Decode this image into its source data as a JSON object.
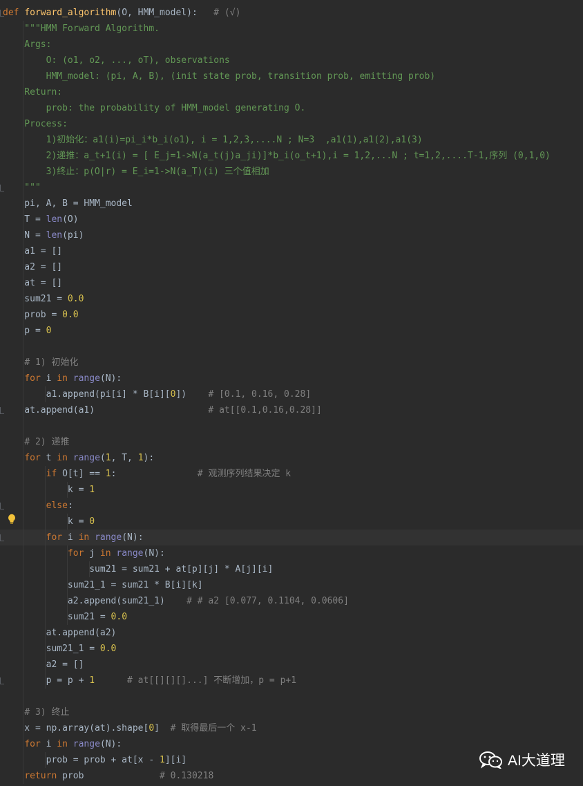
{
  "editor": {
    "lines": [
      "def forward_algorithm(O, HMM_model):   # (√)",
      "    \"\"\"HMM Forward Algorithm.",
      "    Args:",
      "        O: (o1, o2, ..., oT), observations",
      "        HMM_model: (pi, A, B), (init state prob, transition prob, emitting prob)",
      "    Return:",
      "        prob: the probability of HMM_model generating O.",
      "    Process:",
      "        1)初始化：a1(i)=pi_i*b_i(o1), i = 1,2,3,....N ; N=3  ,a1(1),a1(2),a1(3)",
      "        2)递推：a_t+1(i) = [ E_j=1->N(a_t(j)a_ji)]*b_i(o_t+1),i = 1,2,...N ; t=1,2,....T-1,序列 (0,1,0)",
      "        3)终止：p(O|r) = E_i=1->N(a_T)(i) 三个值相加",
      "    \"\"\"",
      "    pi, A, B = HMM_model",
      "    T = len(O)",
      "    N = len(pi)",
      "    a1 = []",
      "    a2 = []",
      "    at = []",
      "    sum21 = 0.0",
      "    prob = 0.0",
      "    p = 0",
      "",
      "    # 1) 初始化",
      "    for i in range(N):",
      "        a1.append(pi[i] * B[i][0])    # [0.1, 0.16, 0.28]",
      "    at.append(a1)                     # at[[0.1,0.16,0.28]]",
      "",
      "    # 2) 递推",
      "    for t in range(1, T, 1):",
      "        if O[t] == 1:               # 观测序列结果决定 k",
      "            k = 1",
      "        else:",
      "            k = 0",
      "        for i in range(N):",
      "            for j in range(N):",
      "                sum21 = sum21 + at[p][j] * A[j][i]",
      "            sum21_1 = sum21 * B[i][k]",
      "            a2.append(sum21_1)    # # a2 [0.077, 0.1104, 0.0606]",
      "            sum21 = 0.0",
      "        at.append(a2)",
      "        sum21_1 = 0.0",
      "        a2 = []",
      "        p = p + 1      # at[[][][]...] 不断增加，p = p+1",
      "",
      "    # 3) 终止",
      "    x = np.array(at).shape[0]  # 取得最后一个 x-1",
      "    for i in range(N):",
      "        prob = prob + at[x - 1][i]",
      "    return prob              # 0.130218"
    ],
    "cursor_line": 33,
    "colors": {
      "background": "#2b2b2b",
      "keyword": "#cc7832",
      "function": "#ffc66d",
      "builtin": "#8888c6",
      "number": "#6897bb",
      "docstring": "#629755",
      "comment": "#808080"
    }
  },
  "watermark": {
    "text": "AI大道理",
    "icon": "wechat-icon"
  }
}
